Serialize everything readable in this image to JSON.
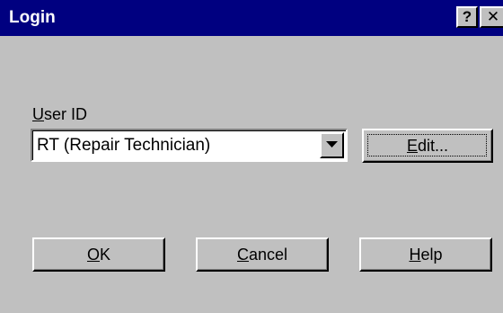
{
  "window": {
    "title": "Login",
    "help_glyph": "?",
    "close_glyph": "✕"
  },
  "user_id": {
    "label_mnemonic": "U",
    "label_rest": "ser ID",
    "selected_value": "RT (Repair Technician)",
    "dropdown_icon": "chevron-down-icon"
  },
  "buttons": {
    "edit": {
      "mnemonic": "E",
      "rest": "dit..."
    },
    "ok": {
      "mnemonic": "O",
      "rest": "K"
    },
    "cancel": {
      "mnemonic": "C",
      "rest": "ancel"
    },
    "help": {
      "mnemonic": "H",
      "rest": "elp"
    }
  },
  "colors": {
    "titlebar": "#000080",
    "face": "#c0c0c0"
  }
}
